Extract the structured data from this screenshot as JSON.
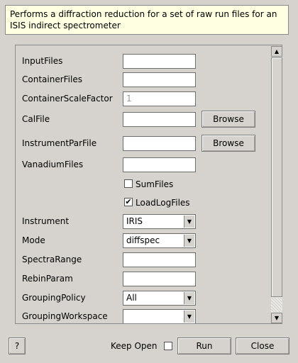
{
  "description": "Performs a diffraction reduction for a set of raw run files for an ISIS indirect spectrometer",
  "fields": {
    "input_files": {
      "label": "InputFiles",
      "value": ""
    },
    "container_files": {
      "label": "ContainerFiles",
      "value": ""
    },
    "container_scale_factor": {
      "label": "ContainerScaleFactor",
      "placeholder": "1"
    },
    "cal_file": {
      "label": "CalFile",
      "value": ""
    },
    "instrument_par_file": {
      "label": "InstrumentParFile",
      "value": ""
    },
    "vanadium_files": {
      "label": "VanadiumFiles",
      "value": ""
    },
    "sum_files": {
      "label": "SumFiles",
      "checked": false
    },
    "load_log_files": {
      "label": "LoadLogFiles",
      "checked": true
    },
    "instrument": {
      "label": "Instrument",
      "value": "IRIS"
    },
    "mode": {
      "label": "Mode",
      "value": "diffspec"
    },
    "spectra_range": {
      "label": "SpectraRange",
      "value": ""
    },
    "rebin_param": {
      "label": "RebinParam",
      "value": ""
    },
    "grouping_policy": {
      "label": "GroupingPolicy",
      "value": "All"
    },
    "grouping_workspace": {
      "label": "GroupingWorkspace",
      "value": ""
    }
  },
  "buttons": {
    "browse": "Browse",
    "help": "?",
    "keep_open": "Keep Open",
    "run": "Run",
    "close": "Close"
  },
  "check_mark": "✔",
  "icons": {
    "scroll_up": "up-arrow-icon",
    "scroll_down": "down-arrow-icon",
    "dropdown": "chevron-down-icon"
  }
}
